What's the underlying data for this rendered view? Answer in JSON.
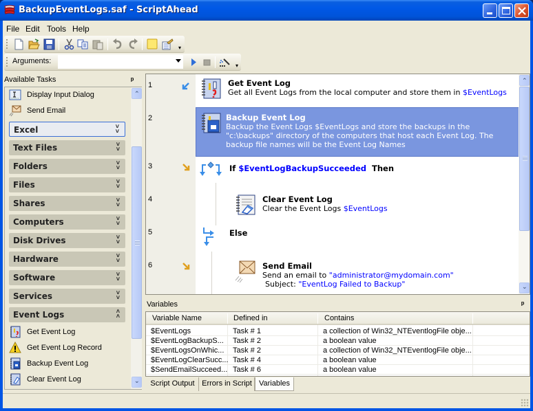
{
  "window": {
    "title": "BackupEventLogs.saf - ScriptAhead",
    "controls": [
      "minimize",
      "maximize",
      "close"
    ]
  },
  "menu": [
    "File",
    "Edit",
    "Tools",
    "Help"
  ],
  "toolbar": {
    "icons": [
      "new-file-icon",
      "open-folder-icon",
      "save-icon",
      "cut-icon",
      "copy-icon",
      "paste-icon",
      "undo-icon",
      "redo-icon",
      "note-icon",
      "properties-icon"
    ],
    "arguments_label": "Arguments:",
    "arguments_value": "",
    "run_icon": "play-icon",
    "stop_icon": "stop-icon",
    "magic_icon": "wand-icon"
  },
  "left_panel": {
    "title": "Available Tasks",
    "top_items": [
      {
        "label": "Display Input Dialog",
        "icon": "input-dialog-icon"
      },
      {
        "label": "Send Email",
        "icon": "email-icon"
      }
    ],
    "groups": [
      {
        "label": "Excel",
        "expanded": false,
        "focused": true
      },
      {
        "label": "Text Files",
        "expanded": false
      },
      {
        "label": "Folders",
        "expanded": false
      },
      {
        "label": "Files",
        "expanded": false
      },
      {
        "label": "Shares",
        "expanded": false
      },
      {
        "label": "Computers",
        "expanded": false
      },
      {
        "label": "Disk Drives",
        "expanded": false
      },
      {
        "label": "Hardware",
        "expanded": false
      },
      {
        "label": "Software",
        "expanded": false
      },
      {
        "label": "Services",
        "expanded": false
      },
      {
        "label": "Event Logs",
        "expanded": true
      }
    ],
    "event_log_items": [
      {
        "label": "Get Event Log",
        "icon": "event-log-icon"
      },
      {
        "label": "Get Event Log Record",
        "icon": "warning-icon"
      },
      {
        "label": "Backup Event Log",
        "icon": "backup-log-icon"
      },
      {
        "label": "Clear Event Log",
        "icon": "clear-log-icon"
      }
    ]
  },
  "script": {
    "steps": [
      {
        "line": "1",
        "title": "Get Event Log",
        "desc_pre": "Get all Event Logs from  the local computer and store them in ",
        "desc_var": "$EventLogs"
      },
      {
        "line": "2",
        "title": "Backup Event Log",
        "desc_lines": [
          "Backup the Event Logs $EventLogs and store the backups in the",
          "\"c:\\backups\" directory of the computers that host each Event Log.  The",
          "backup file names will be the Event Log Names"
        ],
        "selected": true
      },
      {
        "line": "3",
        "kw_if": "If",
        "cond_var": "$EventLogBackupSucceeded",
        "kw_then": "Then"
      },
      {
        "line": "4",
        "title": "Clear Event Log",
        "desc_pre": "Clear the Event Logs ",
        "desc_var": "$EventLogs"
      },
      {
        "line": "5",
        "kw_else": "Else"
      },
      {
        "line": "6",
        "title": "Send Email",
        "desc_pre": "Send an email to ",
        "desc_var": "\"administrator@mydomain.com\"",
        "subject_pre": "Subject: ",
        "subject_var": "\"EventLog Failed to Backup\""
      }
    ]
  },
  "variables": {
    "title": "Variables",
    "columns": [
      "Variable Name",
      "Defined in",
      "Contains"
    ],
    "rows": [
      [
        "$EventLogs",
        "Task # 1",
        "a collection of Win32_NTEventlogFile obje..."
      ],
      [
        "$EventLogBackupS...",
        "Task # 2",
        "a boolean value"
      ],
      [
        "$EventLogsOnWhic...",
        "Task # 2",
        "a collection of Win32_NTEventlogFile obje..."
      ],
      [
        "$EventLogClearSucc...",
        "Task # 4",
        "a boolean value"
      ],
      [
        "$SendEmailSucceed...",
        "Task # 6",
        "a boolean value"
      ]
    ]
  },
  "bottom_tabs": [
    {
      "label": "Script Output",
      "active": false
    },
    {
      "label": "Errors in Script",
      "active": false
    },
    {
      "label": "Variables",
      "active": true
    }
  ],
  "colors": {
    "titlebar": "#0058e6",
    "selection": "#7a96df",
    "variable_link": "#0000ff",
    "group_header": "#c9c7b6"
  }
}
